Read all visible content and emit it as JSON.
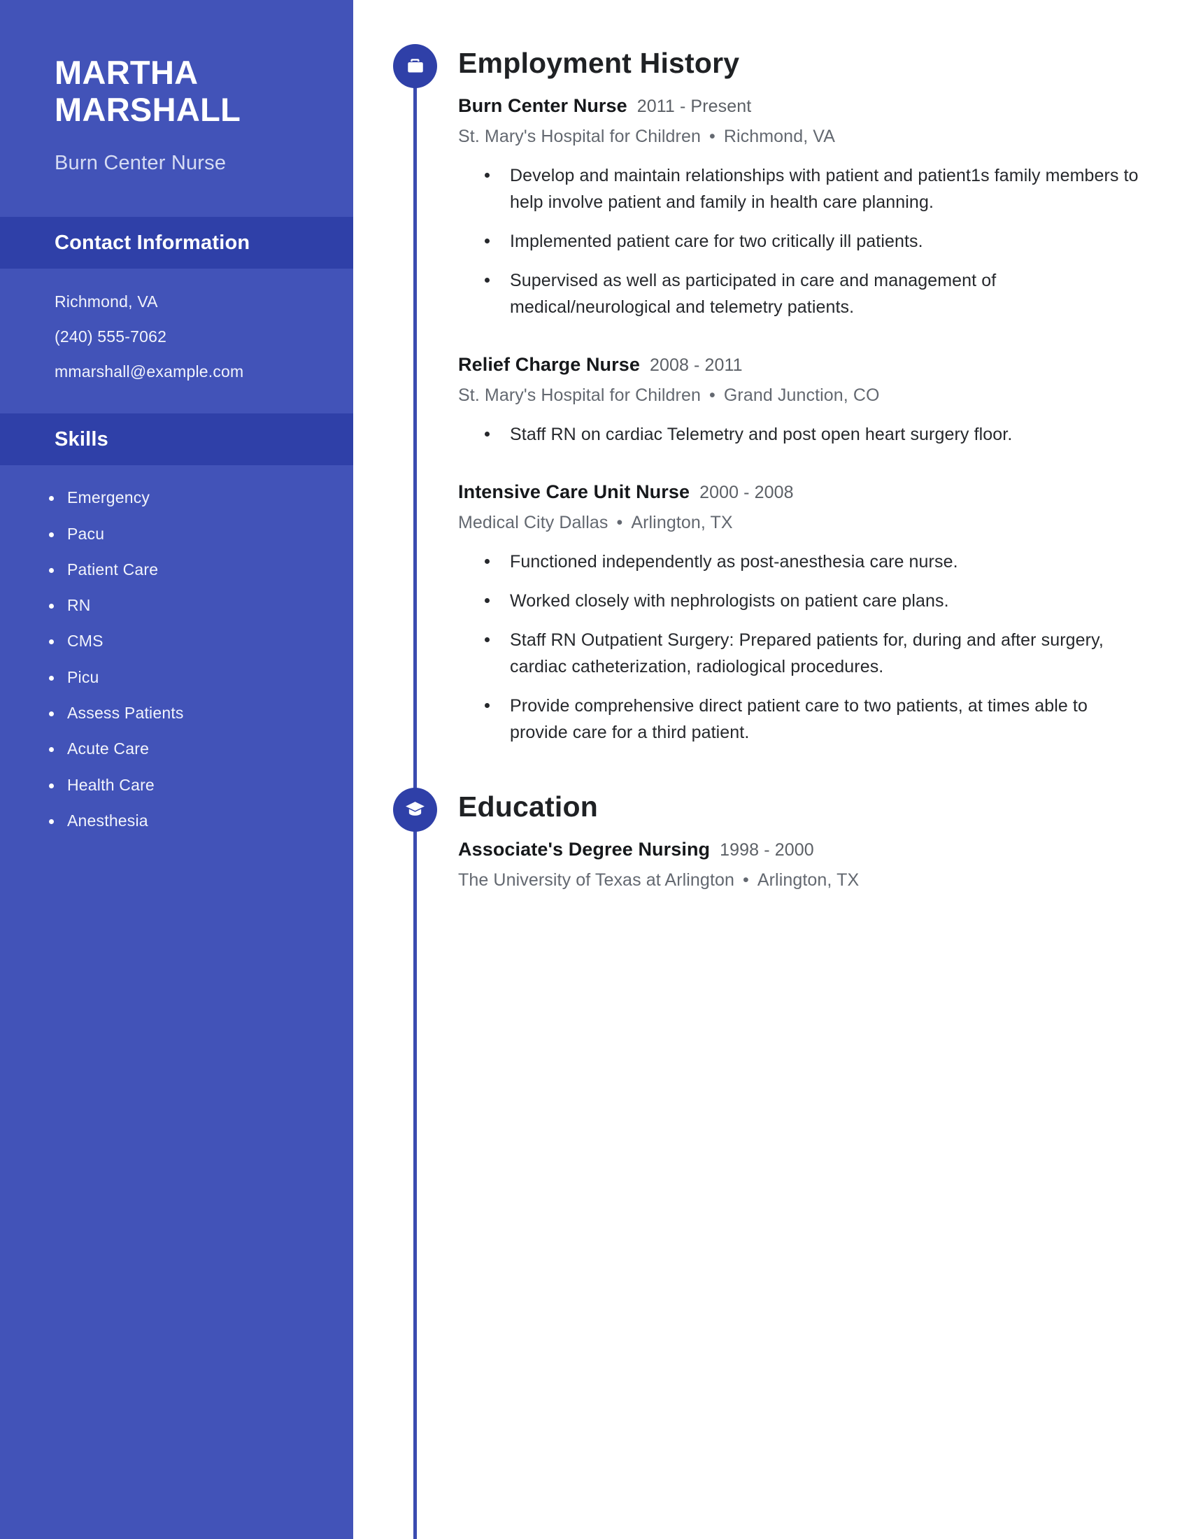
{
  "sidebar": {
    "name": "MARTHA MARSHALL",
    "job_title": "Burn Center Nurse",
    "contact_section": {
      "heading": "Contact Information",
      "location": "Richmond, VA",
      "phone": "(240) 555-7062",
      "email": "mmarshall@example.com"
    },
    "skills_section": {
      "heading": "Skills",
      "items": [
        "Emergency",
        "Pacu",
        "Patient Care",
        "RN",
        "CMS",
        "Picu",
        "Assess Patients",
        "Acute Care",
        "Health Care",
        "Anesthesia"
      ]
    },
    "colors": {
      "background": "#4253b8",
      "band": "#2f40a8",
      "text": "#ffffff",
      "muted_text": "#d6dcf3"
    }
  },
  "main": {
    "employment": {
      "icon": "briefcase-icon",
      "heading": "Employment History",
      "entries": [
        {
          "title": "Burn Center Nurse",
          "dates": "2011 - Present",
          "company": "St. Mary's Hospital for Children",
          "separator": "•",
          "location": "Richmond, VA",
          "bullets": [
            "Develop and maintain relationships with patient and patient1s family members to help involve patient and family in health care planning.",
            "Implemented patient care for two critically ill patients.",
            "Supervised as well as participated in care and management of medical/neurological and telemetry patients."
          ]
        },
        {
          "title": "Relief Charge Nurse",
          "dates": "2008 - 2011",
          "company": "St. Mary's Hospital for Children",
          "separator": "•",
          "location": "Grand Junction, CO",
          "bullets": [
            "Staff RN on cardiac Telemetry and post open heart surgery floor."
          ]
        },
        {
          "title": "Intensive Care Unit Nurse",
          "dates": "2000 - 2008",
          "company": "Medical City Dallas",
          "separator": "•",
          "location": "Arlington, TX",
          "bullets": [
            "Functioned independently as post-anesthesia care nurse.",
            "Worked closely with nephrologists on patient care plans.",
            "Staff RN Outpatient Surgery: Prepared patients for, during and after surgery, cardiac catheterization, radiological procedures.",
            "Provide comprehensive direct patient care to two patients, at times able to provide care for a third patient."
          ]
        }
      ]
    },
    "education": {
      "icon": "graduation-cap-icon",
      "heading": "Education",
      "entries": [
        {
          "title": "Associate's Degree Nursing",
          "dates": "1998 - 2000",
          "school": "The University of Texas at Arlington",
          "separator": "•",
          "location": "Arlington, TX"
        }
      ]
    },
    "colors": {
      "accent": "#2f40a8",
      "rail": "#3a4bb0",
      "heading_text": "#1f2124",
      "body_text": "#26282c",
      "muted_text": "#636870"
    }
  }
}
